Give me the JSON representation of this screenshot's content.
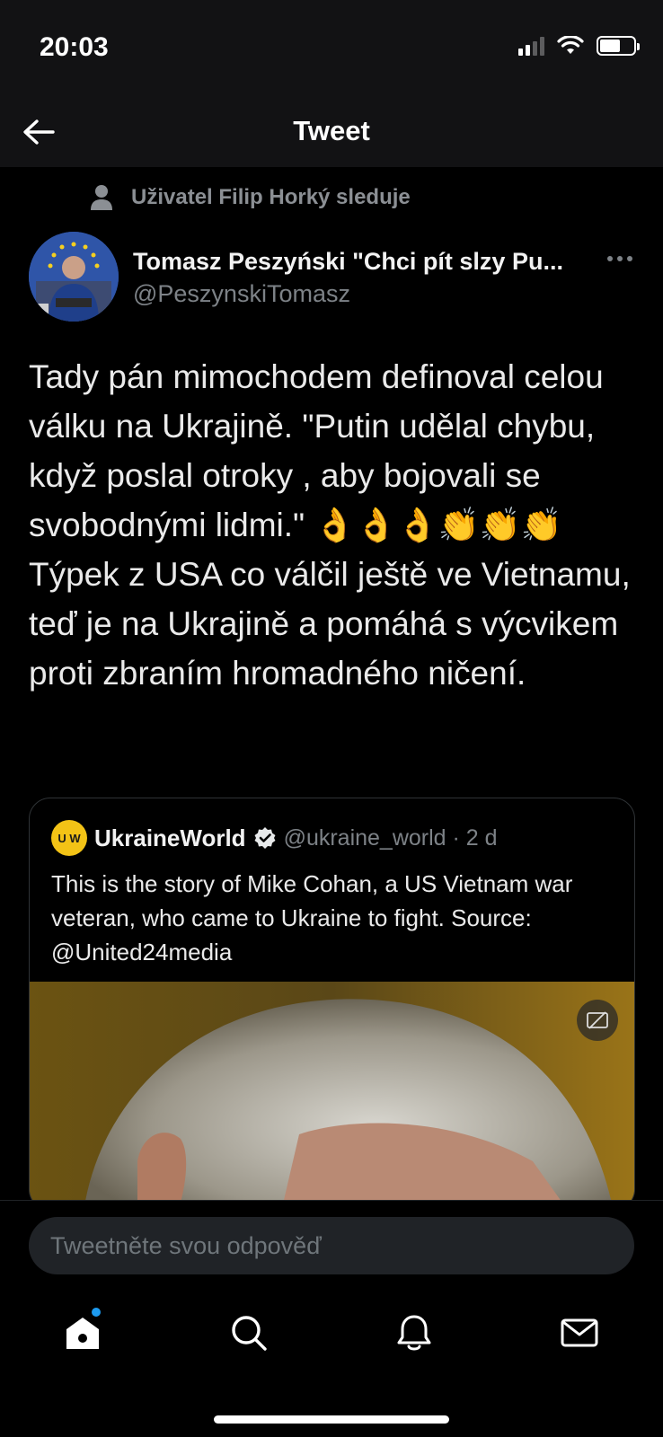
{
  "status": {
    "time": "20:03"
  },
  "nav": {
    "title": "Tweet"
  },
  "social_context": "Uživatel Filip Horký sleduje",
  "author": {
    "name": "Tomasz Peszyński \"Chci pít slzy Pu...",
    "handle": "@PeszynskiTomasz"
  },
  "tweet": {
    "text": "Tady pán mimochodem definoval celou válku na Ukrajině.  \"Putin udělal chybu, když poslal otroky , aby bojovali se svobodnými lidmi.\" 👌👌👌👏👏👏 Týpek z USA co válčil ještě ve Vietnamu, teď je na Ukrajině a pomáhá s výcvikem proti zbraním hromadného ničení."
  },
  "quote": {
    "avatar_text": "U W",
    "name": "UkraineWorld",
    "handle": "@ukraine_world · 2 d",
    "text": "This is the story of Mike Cohan, a US Vietnam war veteran, who came to Ukraine to fight. Source: @United24media"
  },
  "reply": {
    "placeholder": "Tweetněte svou odpověď"
  },
  "tabs": [
    "home-icon",
    "search-icon",
    "notifications-icon",
    "messages-icon"
  ],
  "colors": {
    "accent": "#1d9bf0",
    "background": "#000000",
    "header": "#121214",
    "muted": "#7d8287"
  }
}
